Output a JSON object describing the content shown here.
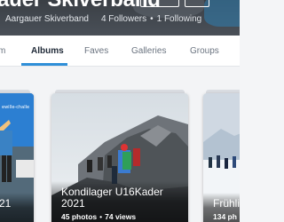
{
  "header": {
    "title": "auer Skiverband",
    "owner": "Aargauer Skiverband",
    "followers": "4 Followers",
    "bullet": "•",
    "following": "1 Following"
  },
  "tabs": [
    {
      "label": "m",
      "active": false
    },
    {
      "label": "Albums",
      "active": true
    },
    {
      "label": "Faves",
      "active": false
    },
    {
      "label": "Galleries",
      "active": false
    },
    {
      "label": "Groups",
      "active": false
    }
  ],
  "colors": {
    "accent": "#2f8fd8",
    "tab_active": "#1f2937"
  },
  "albums": [
    {
      "title": "21",
      "stats_photos": "",
      "stats_views": ""
    },
    {
      "title": "Kondilager U16Kader 2021",
      "stats_photos": "45 photos",
      "stats_views": "74 views"
    },
    {
      "title": "Frühli",
      "stats_photos": "134 ph",
      "stats_views": ""
    }
  ],
  "icons": [
    "user-avatar-icon"
  ]
}
